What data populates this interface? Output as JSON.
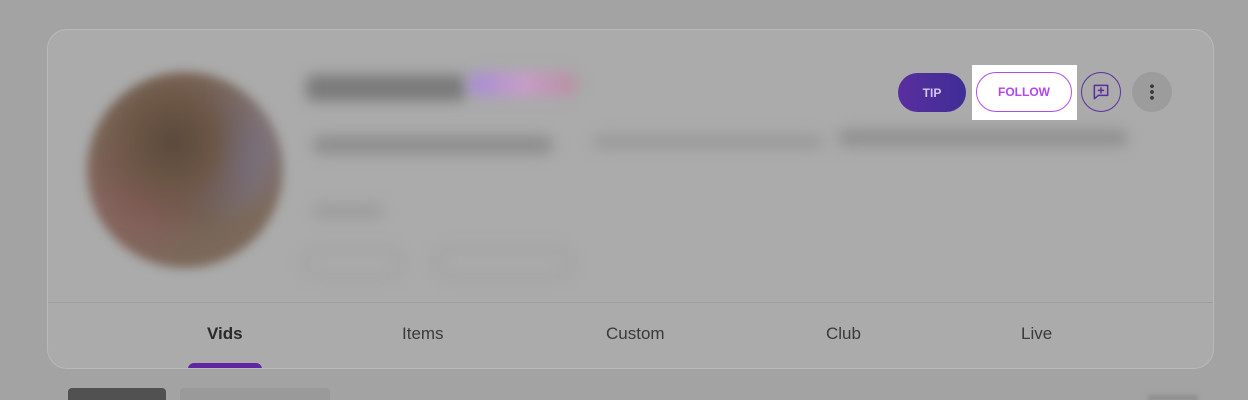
{
  "actions": {
    "tip_label": "TIP",
    "follow_label": "FOLLOW"
  },
  "tabs": [
    {
      "label": "Vids",
      "active": true
    },
    {
      "label": "Items",
      "active": false
    },
    {
      "label": "Custom",
      "active": false
    },
    {
      "label": "Club",
      "active": false
    },
    {
      "label": "Live",
      "active": false
    }
  ],
  "icons": {
    "message": "message-plus-icon",
    "more": "more-vertical-icon"
  },
  "colors": {
    "accent": "#b246f2",
    "tip_gradient_start": "#5a2e9e",
    "tip_gradient_end": "#3f2d96",
    "tab_indicator": "#5f25a3"
  }
}
